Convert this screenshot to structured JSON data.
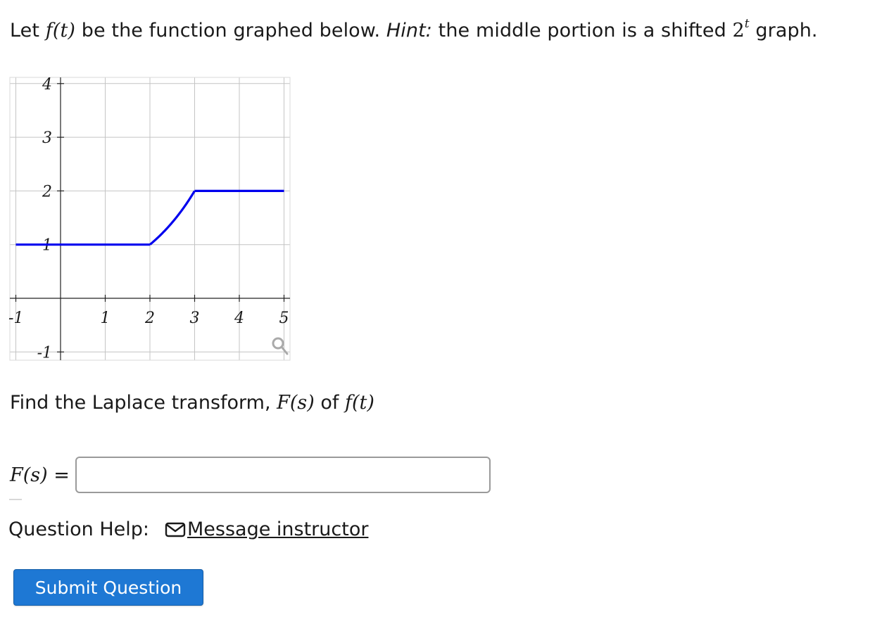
{
  "prompt": {
    "lead": "Let ",
    "func": "f(t)",
    "mid": " be the function graphed below. ",
    "hint_label": "Hint:",
    "hint_text": " the middle portion is a shifted ",
    "base": "2",
    "exponent": "t",
    "tail": " graph."
  },
  "chart_data": {
    "type": "line",
    "xlim": [
      -1,
      5
    ],
    "ylim": [
      -1,
      4
    ],
    "x_ticks": [
      "-1",
      "1",
      "2",
      "3",
      "4",
      "5"
    ],
    "y_ticks": [
      "4",
      "3",
      "2",
      "1",
      "-1"
    ],
    "grid": true,
    "series": [
      {
        "color": "#0000ee",
        "segments": [
          {
            "kind": "constant",
            "x": [
              -1,
              2
            ],
            "y": 1
          },
          {
            "kind": "exponential",
            "formula": "2^(t-2)",
            "x": [
              2,
              3
            ],
            "y": [
              1,
              2
            ]
          },
          {
            "kind": "constant",
            "x": [
              3,
              5
            ],
            "y": 2
          }
        ]
      }
    ]
  },
  "graph_tools": {
    "zoom_icon": "magnifier-icon"
  },
  "question": {
    "lead": "Find the Laplace transform, ",
    "F": "F(s)",
    "of": " of ",
    "f": "f(t)"
  },
  "answer": {
    "label": "F(s)",
    "equals": " =",
    "value": "",
    "placeholder": ""
  },
  "help": {
    "label": "Question Help:",
    "link_icon": "envelope-icon",
    "link_text": "Message instructor"
  },
  "submit": {
    "label": "Submit Question",
    "color": "#1e78d4"
  }
}
